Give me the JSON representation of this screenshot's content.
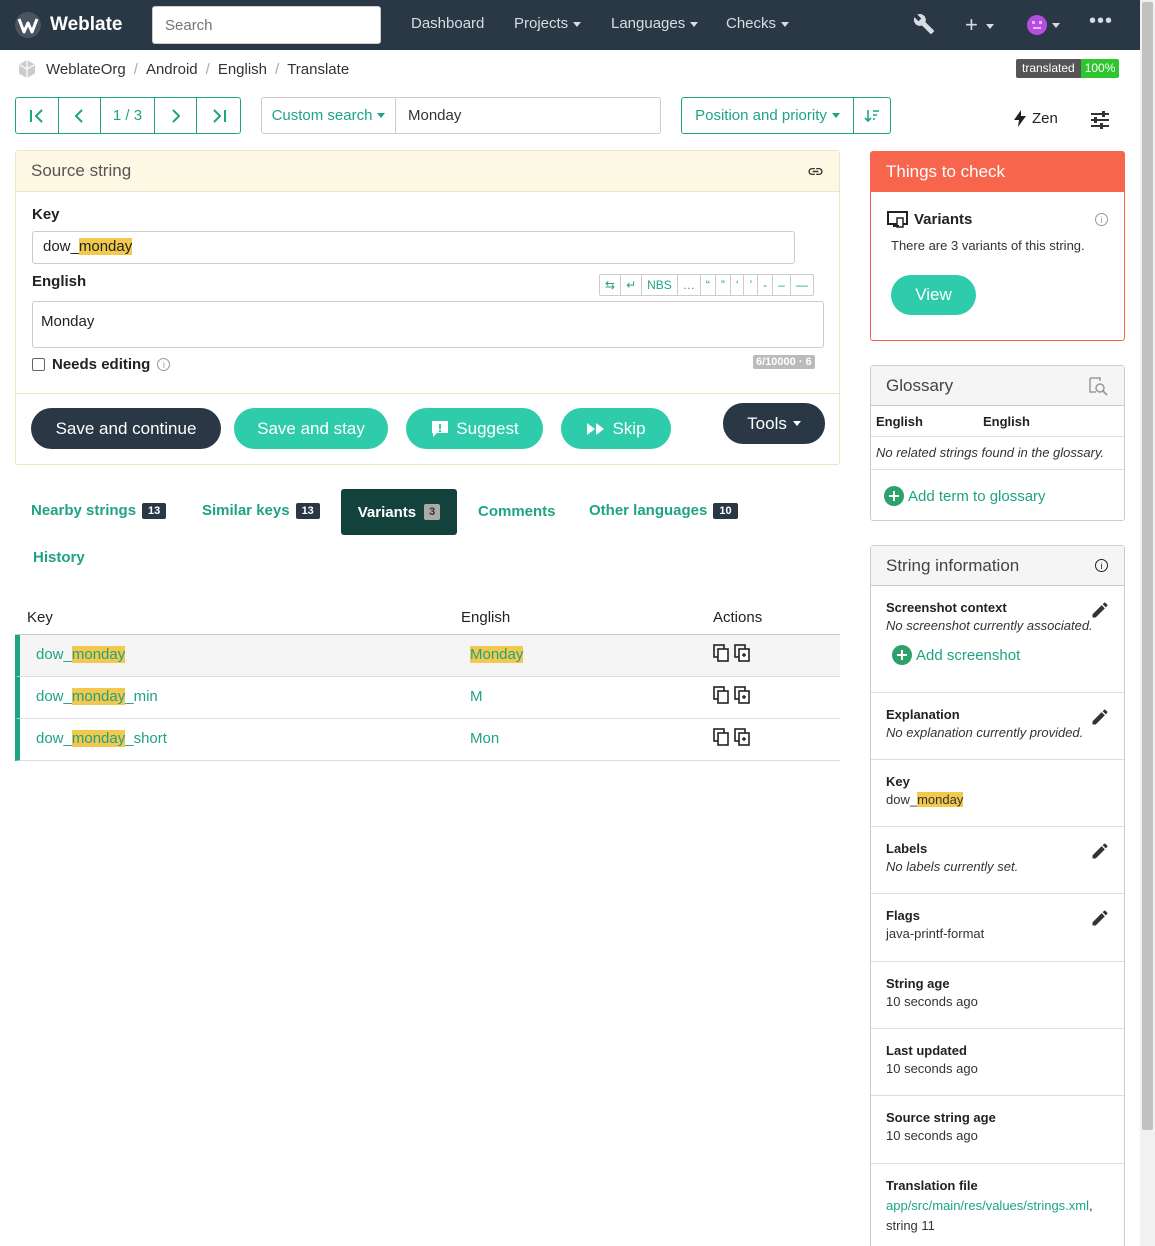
{
  "nav": {
    "brand": "Weblate",
    "search_placeholder": "Search",
    "items": [
      "Dashboard",
      "Projects",
      "Languages",
      "Checks"
    ]
  },
  "breadcrumb": [
    "WeblateOrg",
    "Android",
    "English",
    "Translate"
  ],
  "status_badge": {
    "label": "translated",
    "value": "100%"
  },
  "pager": {
    "position": "1 / 3"
  },
  "search": {
    "custom_label": "Custom search",
    "query": "Monday",
    "sort_label": "Position and priority"
  },
  "zen_label": "Zen",
  "source": {
    "header": "Source string",
    "key_label": "Key",
    "key_prefix": "dow_",
    "key_highlight": "monday",
    "lang_label": "English",
    "text": "Monday",
    "special_chars": [
      "⇆",
      "↵",
      "NBS",
      "…",
      "“",
      "”",
      "‘",
      "’",
      "-",
      "–",
      "—"
    ],
    "needs_editing_label": "Needs editing",
    "counter": "6/10000 · 6"
  },
  "actions": {
    "save_continue": "Save and continue",
    "save_stay": "Save and stay",
    "suggest": "Suggest",
    "skip": "Skip",
    "tools": "Tools"
  },
  "tabs": [
    {
      "label": "Nearby strings",
      "count": "13"
    },
    {
      "label": "Similar keys",
      "count": "13"
    },
    {
      "label": "Variants",
      "count": "3"
    },
    {
      "label": "Comments",
      "count": ""
    },
    {
      "label": "Other languages",
      "count": "10"
    },
    {
      "label": "History",
      "count": ""
    }
  ],
  "variants_table": {
    "headers": [
      "Key",
      "English",
      "Actions"
    ],
    "rows": [
      {
        "pre": "dow_",
        "hl": "monday",
        "post": "",
        "value": "Monday"
      },
      {
        "pre": "dow_",
        "hl": "monday",
        "post": "_min",
        "value": "M"
      },
      {
        "pre": "dow_",
        "hl": "monday",
        "post": "_short",
        "value": "Mon"
      }
    ]
  },
  "checks": {
    "header": "Things to check",
    "title": "Variants",
    "desc": "There are 3 variants of this string.",
    "view_label": "View"
  },
  "glossary": {
    "header": "Glossary",
    "col1": "English",
    "col2": "English",
    "empty": "No related strings found in the glossary.",
    "add_label": "Add term to glossary"
  },
  "info": {
    "header": "String information",
    "screenshot_title": "Screenshot context",
    "screenshot_value": "No screenshot currently associated.",
    "add_screenshot": "Add screenshot",
    "explanation_title": "Explanation",
    "explanation_value": "No explanation currently provided.",
    "key_title": "Key",
    "key_prefix": "dow_",
    "key_highlight": "monday",
    "labels_title": "Labels",
    "labels_value": "No labels currently set.",
    "flags_title": "Flags",
    "flags_value": "java-printf-format",
    "age_title": "String age",
    "age_value": "10 seconds ago",
    "updated_title": "Last updated",
    "updated_value": "10 seconds ago",
    "source_age_title": "Source string age",
    "source_age_value": "10 seconds ago",
    "file_title": "Translation file",
    "file_link": "app/src/main/res/values/strings.xml",
    "file_suffix": "string 11"
  },
  "colors": {
    "accent": "#1fa385",
    "nav_bg": "#2a3744",
    "check_header": "#f7654d",
    "highlight": "#f2c94c"
  }
}
